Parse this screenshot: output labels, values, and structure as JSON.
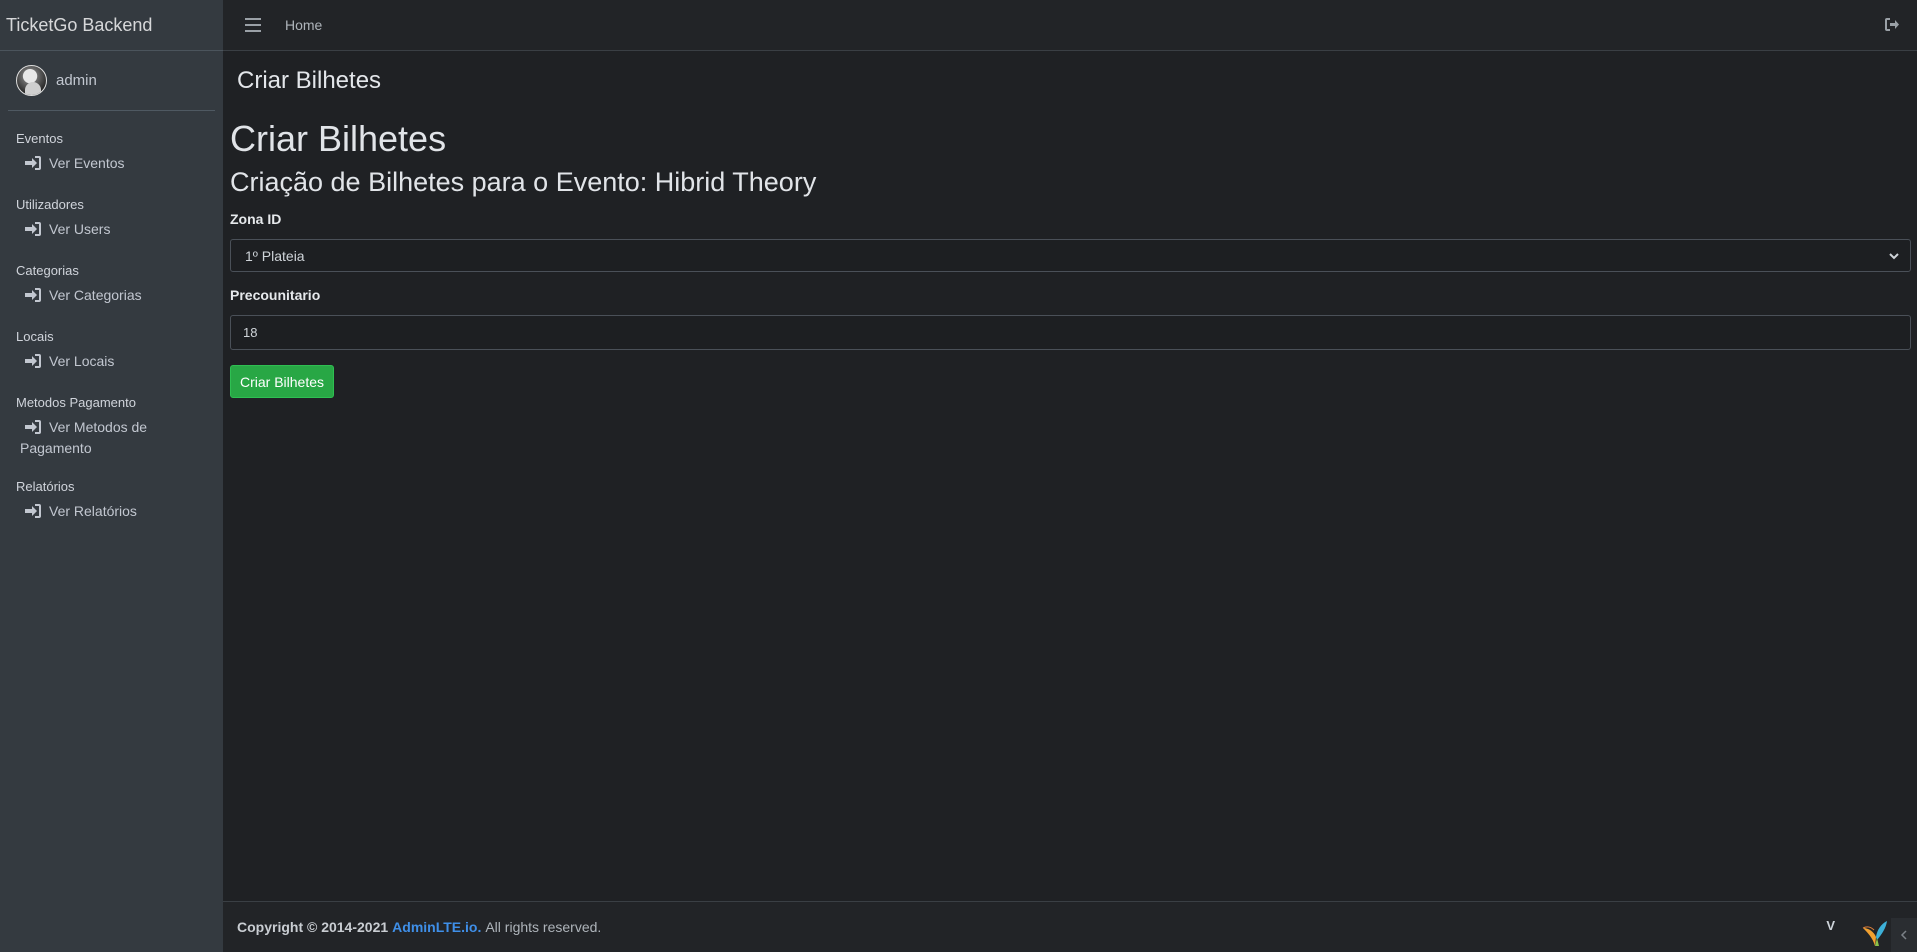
{
  "brand": "TicketGo Backend",
  "user": {
    "name": "admin"
  },
  "nav": [
    {
      "header": "Eventos",
      "item": "Ver Eventos"
    },
    {
      "header": "Utilizadores",
      "item": "Ver Users"
    },
    {
      "header": "Categorias",
      "item": "Ver Categorias"
    },
    {
      "header": "Locais",
      "item": "Ver Locais"
    },
    {
      "header": "Metodos Pagamento",
      "item_line1": "Ver Metodos de",
      "item_line2": "Pagamento"
    },
    {
      "header": "Relatórios",
      "item": "Ver Relatórios"
    }
  ],
  "topbar": {
    "home": "Home"
  },
  "page": {
    "header_title": "Criar Bilhetes",
    "title": "Criar Bilhetes",
    "subtitle": "Criação de Bilhetes para o Evento: Hibrid Theory"
  },
  "form": {
    "zona_label": "Zona ID",
    "zona_value": "1º Plateia",
    "preco_label": "Precounitario",
    "preco_value": "18",
    "submit_label": "Criar Bilhetes"
  },
  "footer": {
    "copyright": "Copyright © 2014-2021",
    "link": "AdminLTE.io.",
    "rights": "All rights reserved.",
    "version": "V"
  },
  "colors": {
    "sidebar": "#343a40",
    "body": "#1f2124",
    "accent_button": "#28a745",
    "link": "#3f8fe8"
  },
  "icons": [
    "bars-icon",
    "sign-out-icon",
    "sign-in-icon",
    "chevron-down-icon",
    "yii-logo-icon",
    "chevron-left-icon"
  ]
}
